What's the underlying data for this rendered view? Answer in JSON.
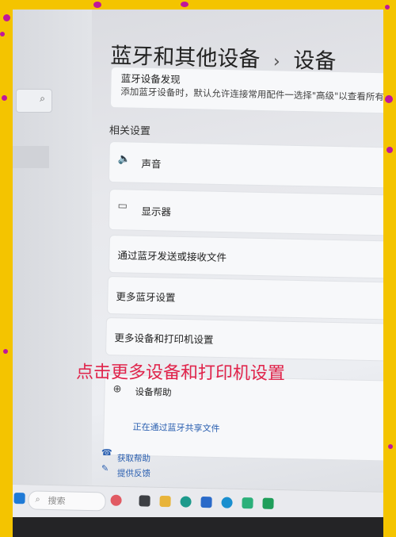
{
  "page": {
    "title_part1": "蓝牙和其他设备",
    "title_sep": "›",
    "title_part2": "设备"
  },
  "discovery": {
    "heading": "蓝牙设备发现",
    "description": "添加蓝牙设备时，默认允许连接常用配件一选择\"高级\"以查看所有类型"
  },
  "related_settings": {
    "heading": "相关设置",
    "items": [
      {
        "label": "声音",
        "icon": "speaker-icon"
      },
      {
        "label": "显示器",
        "icon": "monitor-icon"
      },
      {
        "label": "通过蓝牙发送或接收文件",
        "icon": ""
      },
      {
        "label": "更多蓝牙设置",
        "icon": ""
      },
      {
        "label": "更多设备和打印机设置",
        "icon": ""
      }
    ]
  },
  "help": {
    "label": "设备帮助",
    "link": "正在通过蓝牙共享文件"
  },
  "footer": {
    "get_help": "获取帮助",
    "feedback": "提供反馈"
  },
  "annotation": "点击更多设备和打印机设置",
  "taskbar": {
    "search_placeholder": "搜索"
  },
  "colors": {
    "frame": "#f4c400",
    "dots": "#c0169b",
    "annotation": "#e0234a",
    "link": "#2a5fb0"
  }
}
